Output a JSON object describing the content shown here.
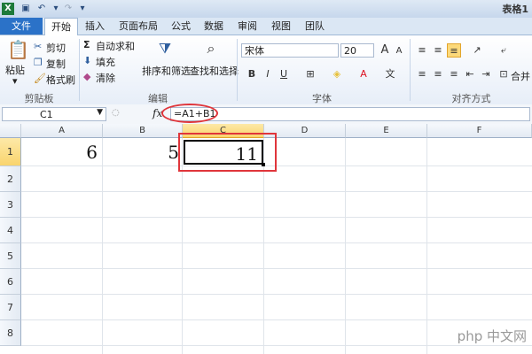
{
  "window": {
    "title": "表格1"
  },
  "tabs": {
    "file": "文件",
    "home": "开始",
    "insert": "插入",
    "layout": "页面布局",
    "formulas": "公式",
    "data": "数据",
    "review": "审阅",
    "view": "视图",
    "team": "团队"
  },
  "ribbon": {
    "clipboard": {
      "paste": "粘贴",
      "cut": "剪切",
      "copy": "复制",
      "format_painter": "格式刷",
      "label": "剪贴板"
    },
    "editing": {
      "autosum": "自动求和",
      "fill": "填充",
      "clear": "清除",
      "sort_filter": "排序和筛选",
      "find_select": "查找和选择",
      "label": "编辑"
    },
    "font": {
      "name": "宋体",
      "size": "20",
      "label": "字体"
    },
    "alignment": {
      "merge": "合并",
      "label": "对齐方式"
    }
  },
  "formula_bar": {
    "name_box": "C1",
    "fx": "fx",
    "formula": "=A1+B1"
  },
  "grid": {
    "columns": [
      "A",
      "B",
      "C",
      "D",
      "E",
      "F"
    ],
    "rows": [
      "1",
      "2",
      "3",
      "4",
      "5",
      "6",
      "7",
      "8"
    ],
    "cells": {
      "A1": "6",
      "B1": "5",
      "C1": "11"
    }
  },
  "colors": {
    "file_tab": "#2b72c8",
    "highlight": "#e0353b",
    "selected_header": "#f9d46d"
  },
  "watermark": "php 中文网"
}
